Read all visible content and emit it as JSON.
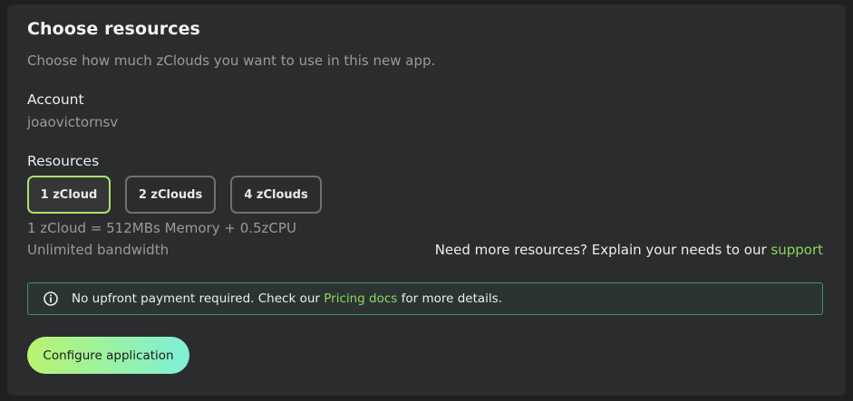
{
  "header": {
    "title": "Choose resources",
    "subtitle": "Choose how much zClouds you want to use in this new app."
  },
  "account": {
    "label": "Account",
    "value": "joaovictornsv"
  },
  "resources": {
    "label": "Resources",
    "options": [
      {
        "label": "1 zCloud",
        "selected": true
      },
      {
        "label": "2 zClouds",
        "selected": false
      },
      {
        "label": "4 zClouds",
        "selected": false
      }
    ],
    "spec": "1 zCloud = 512MBs Memory + 0.5zCPU",
    "bandwidth": "Unlimited bandwidth",
    "help_text": "Need more resources? Explain your needs to our ",
    "help_link": "support"
  },
  "notice": {
    "icon": "info-icon",
    "text_before": "No upfront payment required. Check our ",
    "link": "Pricing docs",
    "text_after": " for more details."
  },
  "actions": {
    "configure_label": "Configure application"
  },
  "colors": {
    "accent": "#8ed65b",
    "selected_border": "#a7e36a",
    "notice_border": "#3f8f72",
    "cta_gradient_start": "#b9f36f",
    "cta_gradient_end": "#7ef0d8"
  }
}
